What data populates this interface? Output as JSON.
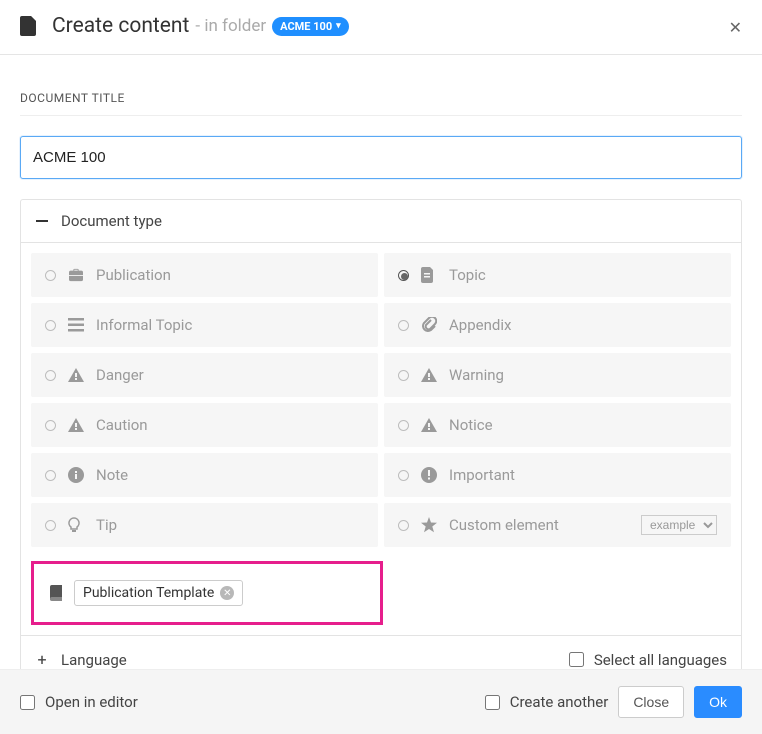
{
  "header": {
    "title": "Create content",
    "subtitle": "- in folder",
    "folder_name": "ACME 100"
  },
  "section": {
    "title_label": "DOCUMENT TITLE",
    "title_value": "ACME 100"
  },
  "doc_type": {
    "header": "Document type",
    "items": [
      {
        "label": "Publication",
        "icon": "briefcase",
        "selected": false
      },
      {
        "label": "Topic",
        "icon": "document",
        "selected": true
      },
      {
        "label": "Informal Topic",
        "icon": "list",
        "selected": false
      },
      {
        "label": "Appendix",
        "icon": "clip",
        "selected": false
      },
      {
        "label": "Danger",
        "icon": "warning",
        "selected": false
      },
      {
        "label": "Warning",
        "icon": "warning",
        "selected": false
      },
      {
        "label": "Caution",
        "icon": "warning",
        "selected": false
      },
      {
        "label": "Notice",
        "icon": "warning",
        "selected": false
      },
      {
        "label": "Note",
        "icon": "info",
        "selected": false
      },
      {
        "label": "Important",
        "icon": "important",
        "selected": false
      },
      {
        "label": "Tip",
        "icon": "bulb",
        "selected": false
      },
      {
        "label": "Custom element",
        "icon": "star",
        "selected": false,
        "dropdown": "example"
      }
    ],
    "template_tag": "Publication Template"
  },
  "language": {
    "header": "Language",
    "select_all": "Select all languages"
  },
  "footer": {
    "open_in_editor": "Open in editor",
    "create_another": "Create another",
    "close": "Close",
    "ok": "Ok"
  }
}
